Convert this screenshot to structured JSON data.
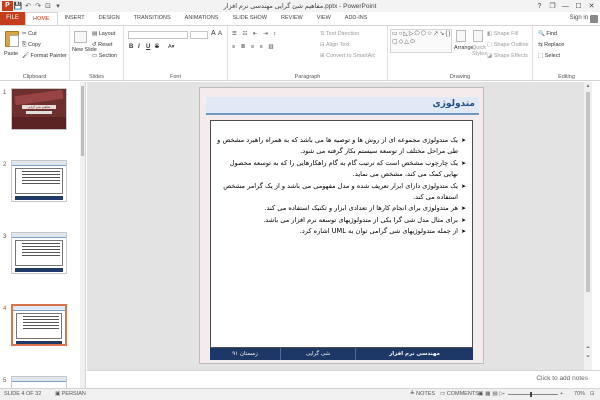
{
  "window": {
    "title": "مفاهیم شئ گرایی مهندسی نرم افزار.pptx - PowerPoint",
    "app_badge": "P",
    "controls": [
      "?",
      "❐",
      "—",
      "☐",
      "✕"
    ]
  },
  "qat": {
    "save": "💾",
    "undo": "↶",
    "redo": "↷",
    "start": "⊡",
    "more": "▾"
  },
  "tabs": {
    "file": "FILE",
    "items": [
      "HOME",
      "INSERT",
      "DESIGN",
      "TRANSITIONS",
      "ANIMATIONS",
      "SLIDE SHOW",
      "REVIEW",
      "VIEW",
      "ADD-INS"
    ],
    "active": "HOME",
    "signin": "Sign in"
  },
  "ribbon": {
    "clipboard": {
      "paste": "Paste",
      "cut": "Cut",
      "copy": "Copy",
      "format_painter": "Format Painter",
      "label": "Clipboard"
    },
    "slides": {
      "new_slide": "New Slide",
      "layout": "Layout",
      "reset": "Reset",
      "section": "Section",
      "label": "Slides"
    },
    "font": {
      "bold": "B",
      "italic": "I",
      "underline": "U",
      "strike": "S",
      "label": "Font"
    },
    "paragraph": {
      "text_direction": "Text Direction",
      "align_text": "Align Text",
      "convert_smartart": "Convert to SmartArt",
      "label": "Paragraph"
    },
    "drawing": {
      "arrange": "Arrange",
      "quick_styles": "Quick Styles",
      "shape_fill": "Shape Fill",
      "shape_outline": "Shape Outline",
      "shape_effects": "Shape Effects",
      "label": "Drawing"
    },
    "editing": {
      "find": "Find",
      "replace": "Replace",
      "select": "Select",
      "label": "Editing"
    }
  },
  "thumbnails": {
    "numbers": [
      "1",
      "2",
      "3",
      "4",
      "5"
    ],
    "selected": "4",
    "slide1_title": "مفاهیم شئ گرایی"
  },
  "slide": {
    "title": "متدولوژی",
    "bullets": [
      "یک متدولوژی مجموعه ای از روش ها و توصیه ها می باشد که به همراه راهبرد مشخص و طی مراحل مختلف از توسعه سیستم بکار گرفته می شود.",
      "یک چارچوب مشخص است که ترتیب گام به گام راهکارهایی را که به توسعه محصول نهایی کمک می کند، مشخص می نماید.",
      "یک متدولوژی دارای ابزار تعریف شده و مدل مفهومی می باشد و از یک گرامر مشخص استفاده می کند.",
      "هر متدولوژی برای انجام کارها از تعدادی ابزار و تکنیک استفاده می کند.",
      "برای مثال مدل شی گرا یکی از متدولوژیهای توسعه نرم افزار می باشد.",
      "از جمله متدولوژیهای شی گرامی توان به UML اشاره کرد."
    ],
    "footer": {
      "course": "مهندسی نرم افزار",
      "topic": "شی گرایی",
      "date": "زمستان ۹۱"
    }
  },
  "notes": {
    "placeholder": "Click to add notes"
  },
  "status": {
    "slide_info": "SLIDE 4 OF 32",
    "language": "PERSIAN",
    "notes": "NOTES",
    "comments": "COMMENTS",
    "zoom": "70%"
  },
  "colors": {
    "accent": "#c43e1c",
    "footer_bg": "#1d3766",
    "title_text": "#1f4e8c"
  }
}
